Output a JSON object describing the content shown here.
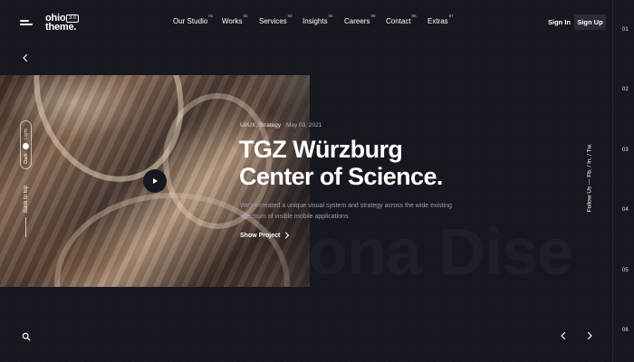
{
  "header": {
    "logo": {
      "line1": "ohio",
      "line2": "theme.",
      "version": "3.0"
    },
    "nav": [
      {
        "label": "Our Studio",
        "num": "01"
      },
      {
        "label": "Works",
        "num": "02"
      },
      {
        "label": "Services",
        "num": "03"
      },
      {
        "label": "Insights",
        "num": "04"
      },
      {
        "label": "Careers",
        "num": "05"
      },
      {
        "label": "Contact",
        "num": "06"
      },
      {
        "label": "Extras",
        "num": "07"
      }
    ],
    "sign_in": "Sign In",
    "sign_up": "Sign Up"
  },
  "sidebar": {
    "mode_light": "Light",
    "mode_dark": "Dark",
    "back_to_top": "Back to top"
  },
  "project": {
    "category": "UI/UX, Strategy",
    "date": "May 03, 2021",
    "title_line1": "TGZ Würzburg",
    "title_line2": "Center of Science.",
    "description_line1": "We've created a unique visual system and strategy across the wide existing",
    "description_line2": "spectrum of visible mobile applications.",
    "cta": "Show Project"
  },
  "watermark": "ona Dise",
  "social": "Follow Us — Fb. / In. / Tw.",
  "slides": [
    "01",
    "02",
    "03",
    "04",
    "05",
    "06"
  ],
  "icons": {
    "menu": "menu-icon",
    "back": "chevron-left-icon",
    "play": "play-icon",
    "search": "search-icon",
    "prev": "chevron-left-icon",
    "next": "chevron-right-icon"
  },
  "colors": {
    "background": "#16171f",
    "button": "#2a2b34",
    "text": "#ffffff",
    "muted": "#9fa1ab"
  }
}
